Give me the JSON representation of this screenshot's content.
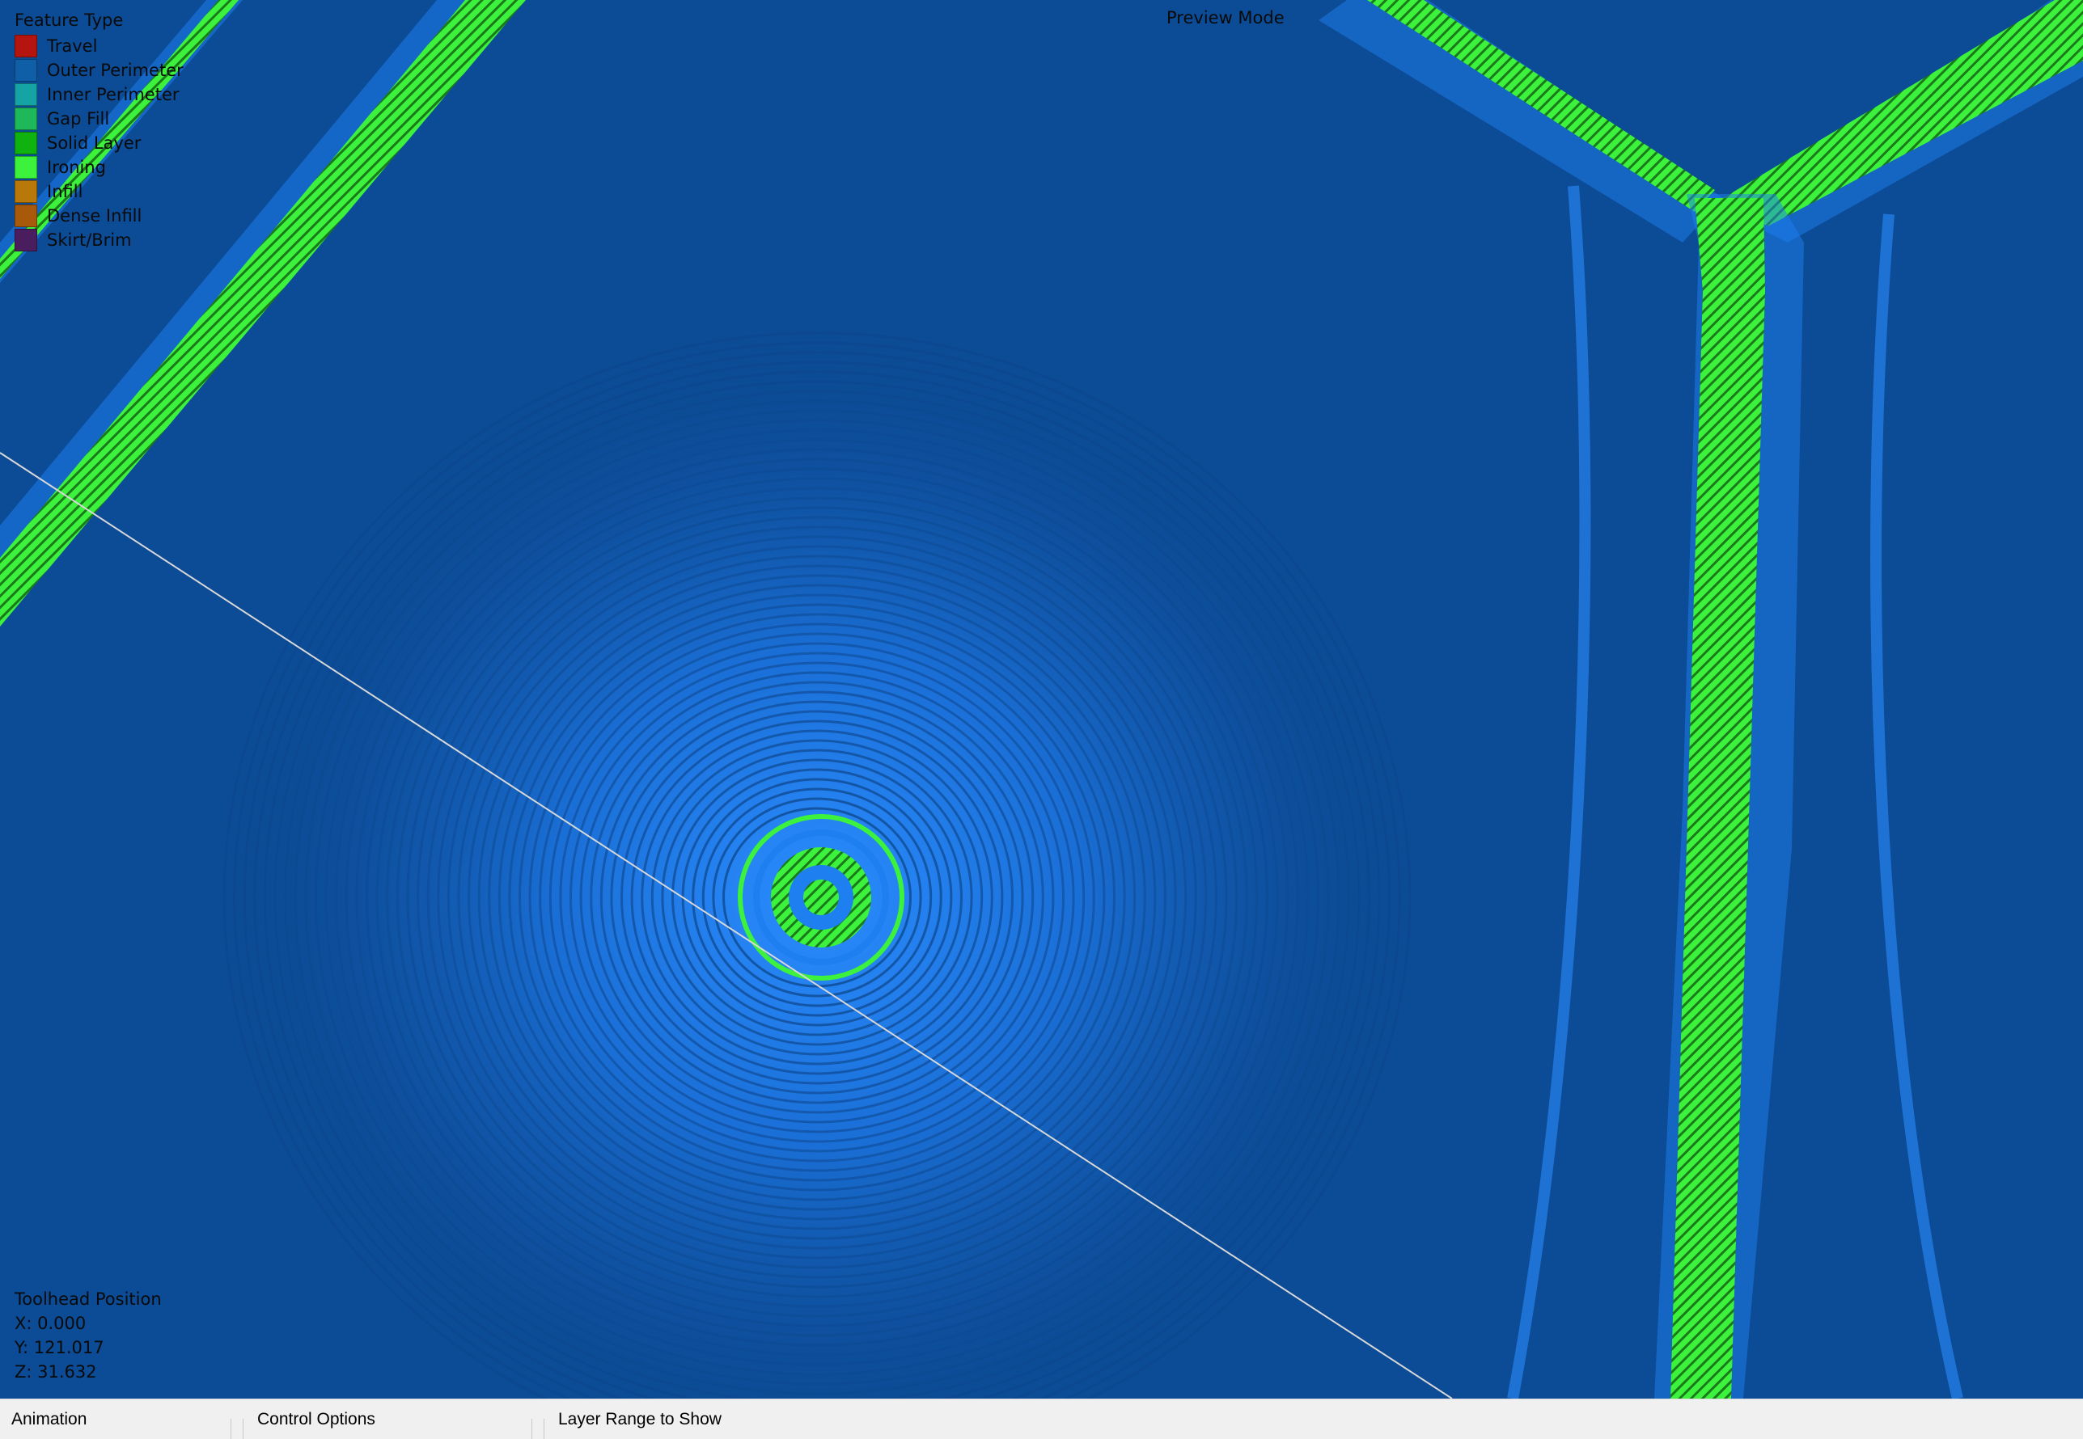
{
  "window": {
    "preview_mode_label": "Preview Mode"
  },
  "legend": {
    "title": "Feature Type",
    "items": [
      {
        "label": "Travel",
        "color": "#b5150f"
      },
      {
        "label": "Outer Perimeter",
        "color": "#0f5fa6"
      },
      {
        "label": "Inner Perimeter",
        "color": "#16a3a6"
      },
      {
        "label": "Gap Fill",
        "color": "#1eb85a"
      },
      {
        "label": "Solid Layer",
        "color": "#0fb20f"
      },
      {
        "label": "Ironing",
        "color": "#3cf23c"
      },
      {
        "label": "Infill",
        "color": "#b8780a"
      },
      {
        "label": "Dense Infill",
        "color": "#a85a0a"
      },
      {
        "label": "Skirt/Brim",
        "color": "#4a1e5e"
      }
    ]
  },
  "toolhead": {
    "title": "Toolhead Position",
    "x": "X: 0.000",
    "y": "Y: 121.017",
    "z": "Z: 31.632"
  },
  "bottom_bar": {
    "tabs": [
      "Animation",
      "Control Options",
      "Layer Range to Show"
    ]
  },
  "colors": {
    "background_blue": "#0c4b95",
    "perimeter_blue": "#1e7ff0",
    "ironing_green": "#3cf23c",
    "travel_line": "#d8d8d8"
  }
}
